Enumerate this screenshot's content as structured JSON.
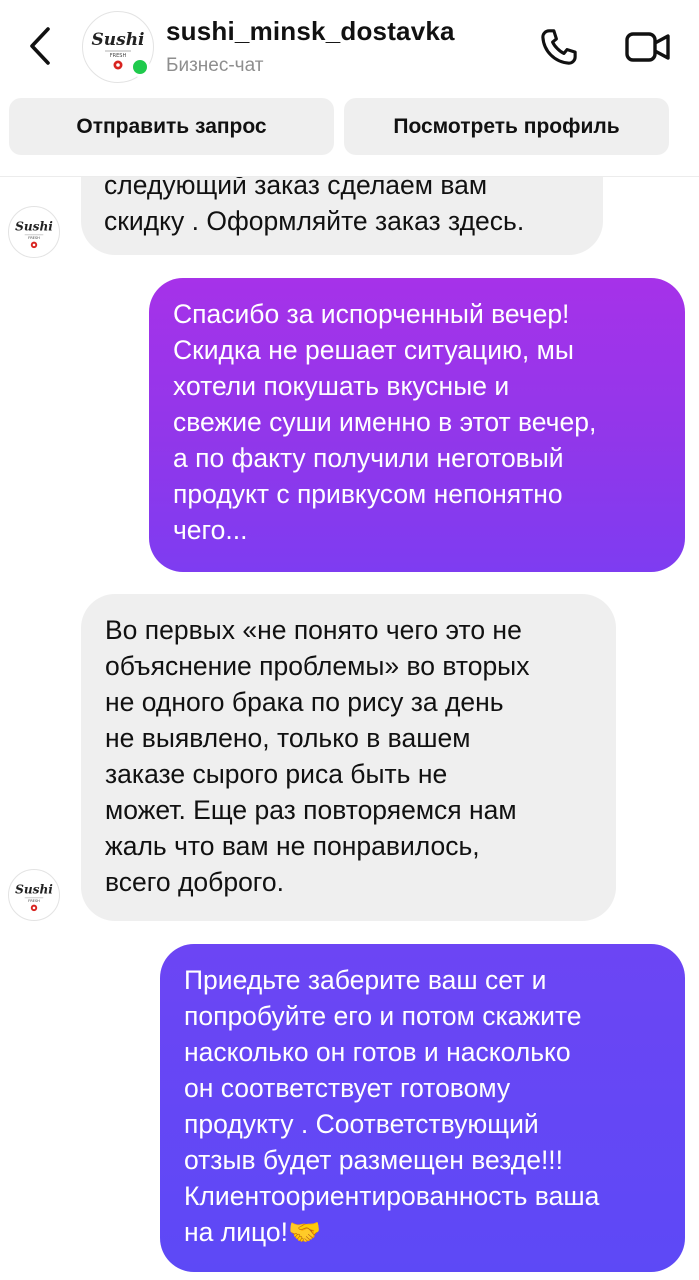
{
  "header": {
    "back_icon": "chevron-left-icon",
    "chat_name": "sushi_minsk_dostavka",
    "subtitle": "Бизнес-чат",
    "avatar_logo_text": "Sushi",
    "avatar_logo_sub": "FRESH",
    "online_color": "#1fca4c",
    "call_icon": "phone-icon",
    "video_icon": "video-camera-icon"
  },
  "actions": {
    "send_request": "Отправить запрос",
    "view_profile": "Посмотреть профиль"
  },
  "messages": [
    {
      "direction": "incoming",
      "text": "следующий заказ сделаем вам\nскидку . Оформляйте заказ здесь."
    },
    {
      "direction": "outgoing",
      "text": "Спасибо за испорченный вечер!\nСкидка не решает ситуацию, мы\nхотели покушать вкусные и\nсвежие суши именно в этот вечер,\nа по факту получили неготовый\nпродукт с привкусом непонятно\nчего..."
    },
    {
      "direction": "incoming",
      "text": "Во первых «не понято чего это не\nобъяснение проблемы» во вторых\nне одного брака по рису за день\nне выявлено, только в вашем\nзаказе сырого риса быть не\nможет. Еще раз повторяемся нам\nжаль что вам не понравилось,\nвсего доброго."
    },
    {
      "direction": "outgoing",
      "text": "Приедьте  заберите ваш сет и\nпопробуйте его  и потом скажите\nнасколько он готов и насколько\nон соответствует готовому\nпродукту . Соответствующий\nотзыв будет размещен везде!!!\nКлиентоориентированность ваша\nна лицо!🤝"
    }
  ],
  "colors": {
    "incoming_bubble": "#efefef",
    "outgoing_bubble_top": "#a632e9",
    "outgoing_bubble_bottom": "#5d49f6"
  }
}
